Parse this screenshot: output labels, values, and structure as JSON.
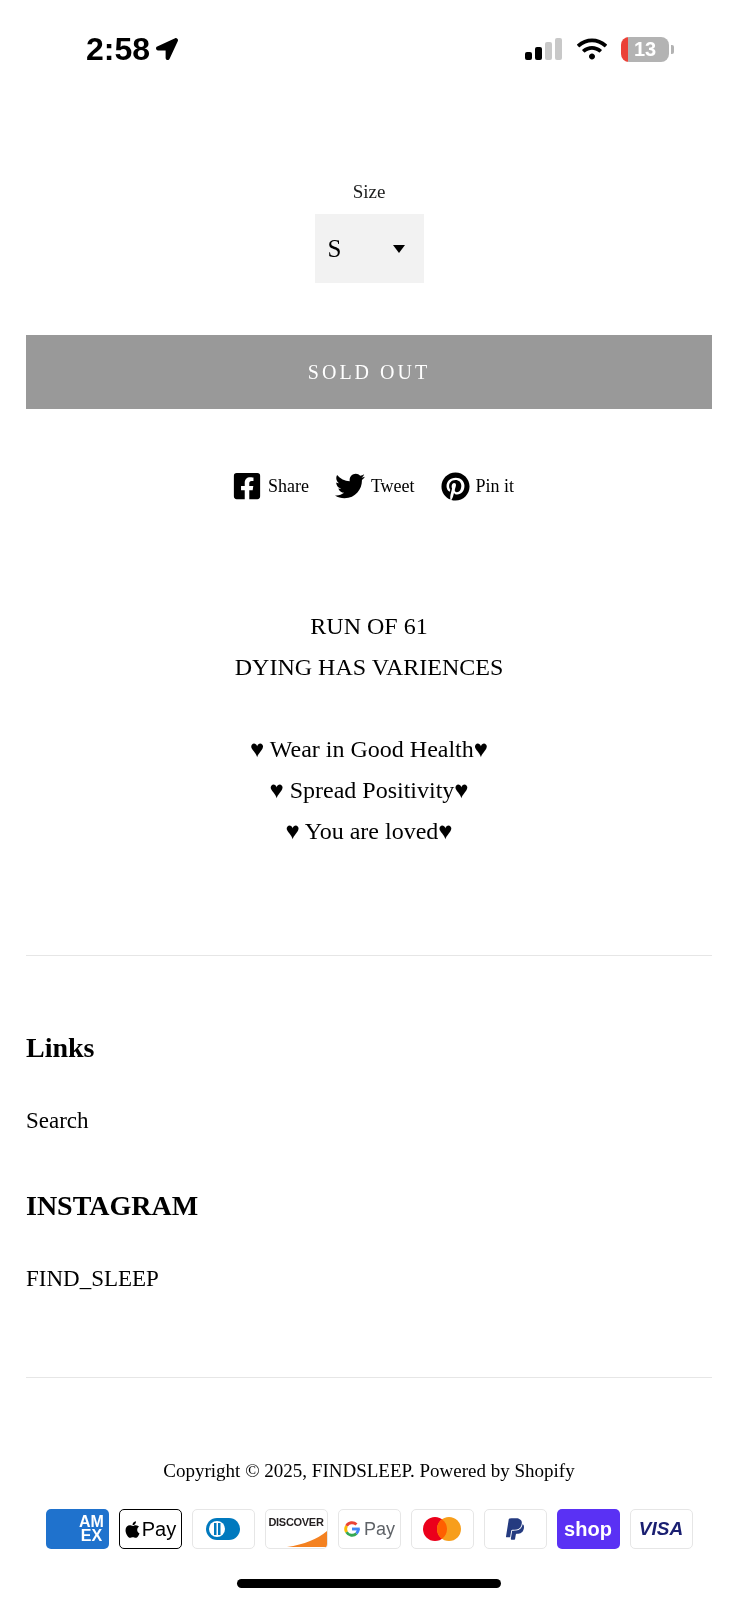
{
  "status_bar": {
    "time": "2:58",
    "battery": "13"
  },
  "size_select": {
    "label": "Size",
    "value": "S"
  },
  "sold_out_button": {
    "label": "SOLD OUT",
    "disabled": true
  },
  "share_links": [
    {
      "kind": "facebook",
      "label": "Share"
    },
    {
      "kind": "twitter",
      "label": "Tweet"
    },
    {
      "kind": "pinterest",
      "label": "Pin it"
    }
  ],
  "description": {
    "paragraphs": [
      [
        "RUN OF 61",
        "DYING HAS VARIENCES"
      ],
      [
        "♥ Wear in Good Health♥",
        "♥ Spread Positivity♥",
        "♥ You are loved♥"
      ]
    ]
  },
  "footer": {
    "blocks": [
      {
        "heading": "Links",
        "links": [
          "Search"
        ]
      },
      {
        "heading": "INSTAGRAM",
        "links": [
          "FIND_SLEEP"
        ]
      }
    ],
    "copyright": "Copyright © 2025, FINDSLEEP. Powered by Shopify",
    "payment_icons": [
      {
        "kind": "amex",
        "text": "AM EX"
      },
      {
        "kind": "applepay",
        "text": "Pay"
      },
      {
        "kind": "diners"
      },
      {
        "kind": "discover",
        "text": "DISCOVER"
      },
      {
        "kind": "googlepay",
        "text": "Pay"
      },
      {
        "kind": "mastercard"
      },
      {
        "kind": "paypal"
      },
      {
        "kind": "shop",
        "text": "shop"
      },
      {
        "kind": "visa",
        "text": "VISA"
      }
    ]
  }
}
